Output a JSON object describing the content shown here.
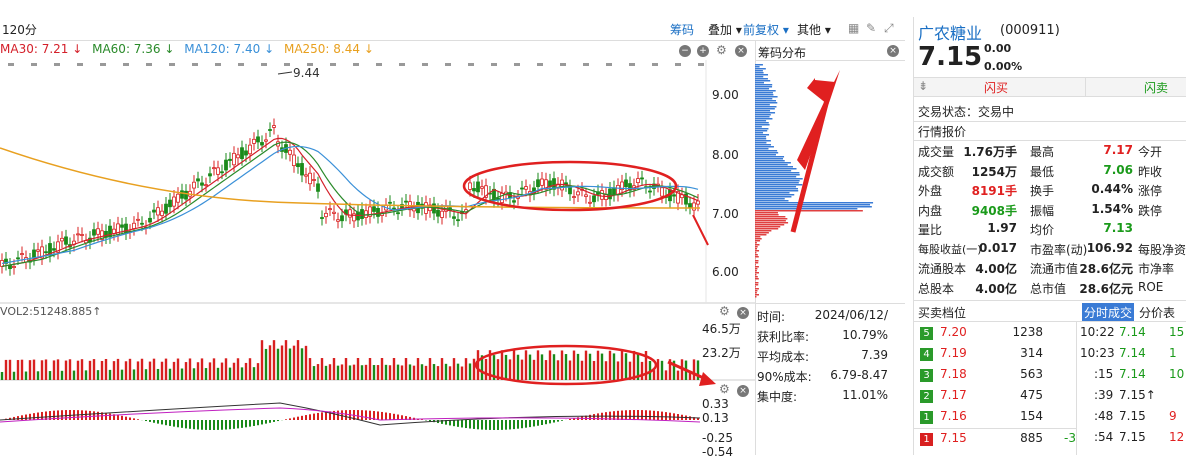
{
  "header": {
    "period": "120分",
    "toolbar": {
      "chips": "筹码",
      "overlay": "叠加",
      "adjust": "前复权",
      "other": "其他"
    }
  },
  "ma": [
    {
      "label": "MA30: 7.21",
      "arrow": "↓",
      "color": "#d4202a"
    },
    {
      "label": "MA60: 7.36",
      "arrow": "↓",
      "color": "#2a8a2a"
    },
    {
      "label": "MA120: 7.40",
      "arrow": "↓",
      "color": "#3a90d8"
    },
    {
      "label": "MA250: 8.44",
      "arrow": "↓",
      "color": "#e8a020"
    }
  ],
  "price_axis": [
    "9.00",
    "8.00",
    "7.00",
    "6.00"
  ],
  "peak_label": "9.44",
  "vol": {
    "label": "VOL2:51248.885↑",
    "axis": [
      "46.5万",
      "23.2万"
    ]
  },
  "macd": {
    "axis": [
      "0.33",
      "0.13",
      "-0.25",
      "-0.54"
    ]
  },
  "chip_panel": {
    "title": "筹码分布",
    "info": [
      {
        "k": "时间:",
        "v": "2024/06/12/"
      },
      {
        "k": "获利比率:",
        "v": "10.79%"
      },
      {
        "k": "平均成本:",
        "v": "7.39"
      },
      {
        "k": "90%成本:",
        "v": "6.79-8.47"
      },
      {
        "k": "集中度:",
        "v": "11.01%"
      }
    ]
  },
  "stock": {
    "name": "广农糖业",
    "code": "(000911)",
    "price": "7.15",
    "change": "0.00",
    "pct": "0.00%",
    "buy": "闪买",
    "sell": "闪卖",
    "status": "交易状态：交易中",
    "quote_title": "行情报价",
    "quotes": [
      [
        "成交量",
        "1.76万手",
        "最高",
        "7.17",
        "今开"
      ],
      [
        "成交额",
        "1254万",
        "最低",
        "7.06",
        "昨收"
      ],
      [
        "外盘",
        "8191手",
        "换手",
        "0.44%",
        "涨停"
      ],
      [
        "内盘",
        "9408手",
        "振幅",
        "1.54%",
        "跌停"
      ],
      [
        "量比",
        "1.97",
        "均价",
        "7.13",
        ""
      ],
      [
        "每股收益(一)",
        "0.017",
        "市盈率(动)",
        "106.92",
        "每股净资产"
      ],
      [
        "流通股本",
        "4.00亿",
        "流通市值",
        "28.6亿元",
        "市净率"
      ],
      [
        "总股本",
        "4.00亿",
        "总市值",
        "28.6亿元",
        "ROE"
      ]
    ],
    "ob_title": "买卖档位",
    "tabs": [
      "分时成交",
      "分价表"
    ],
    "asks": [
      {
        "lvl": "5",
        "price": "7.20",
        "vol": "1238"
      },
      {
        "lvl": "4",
        "price": "7.19",
        "vol": "314"
      },
      {
        "lvl": "3",
        "price": "7.18",
        "vol": "563"
      },
      {
        "lvl": "2",
        "price": "7.17",
        "vol": "475"
      },
      {
        "lvl": "1",
        "price": "7.16",
        "vol": "154"
      }
    ],
    "bid1": {
      "lvl": "1",
      "price": "7.15",
      "vol": "885",
      "extra": "-3"
    },
    "ticks": [
      {
        "t": "10:22",
        "p": "7.14",
        "v": "15"
      },
      {
        "t": "10:23",
        "p": "7.14",
        "v": "1"
      },
      {
        "t": ":15",
        "p": "7.14",
        "v": "10"
      },
      {
        "t": ":39",
        "p": "7.15↑",
        "v": ""
      },
      {
        "t": ":48",
        "p": "7.15",
        "v": "9"
      },
      {
        "t": ":54",
        "p": "7.15",
        "v": "12"
      }
    ]
  }
}
